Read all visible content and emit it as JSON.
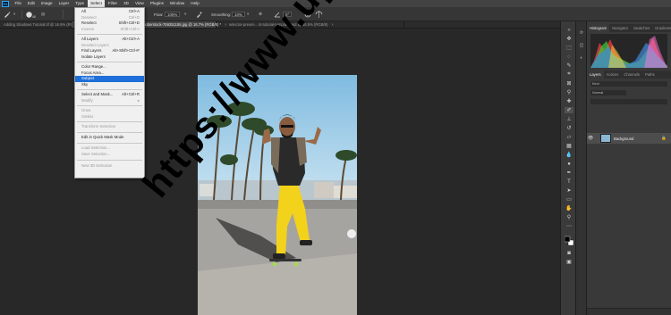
{
  "menubar": {
    "logo": "Ps",
    "items": [
      "File",
      "Edit",
      "Image",
      "Layer",
      "Type",
      "Select",
      "Filter",
      "3D",
      "View",
      "Plugins",
      "Window",
      "Help"
    ]
  },
  "options": {
    "size": "48",
    "flow": "100%",
    "smoothing": "10%",
    "angle": "0°"
  },
  "tabs": [
    {
      "label": "Adding Shadows Tutorial.tif @ 16.9% (RGB/8)",
      "close": "×"
    },
    {
      "label": "shutterstock-759251155.jpg @ 16.7% (RGB/8) *",
      "close": "×"
    },
    {
      "label": "selector-preset-...nt-tutorial-template.psd @ 16.5% (RGB/8)",
      "close": "×"
    }
  ],
  "select_menu": {
    "items": [
      {
        "label": "All",
        "shortcut": "Ctrl+A",
        "disabled": false
      },
      {
        "label": "Deselect",
        "shortcut": "Ctrl+D",
        "disabled": true
      },
      {
        "label": "Reselect",
        "shortcut": "Shift+Ctrl+D",
        "disabled": false
      },
      {
        "label": "Inverse",
        "shortcut": "Shift+Ctrl+I",
        "disabled": true
      },
      {
        "label": "All Layers",
        "shortcut": "Alt+Ctrl+A",
        "disabled": false
      },
      {
        "label": "Deselect Layers",
        "shortcut": "",
        "disabled": true
      },
      {
        "label": "Find Layers",
        "shortcut": "Alt+Shift+Ctrl+F",
        "disabled": false
      },
      {
        "label": "Isolate Layers",
        "shortcut": "",
        "disabled": false
      },
      {
        "label": "Color Range...",
        "shortcut": "",
        "disabled": false
      },
      {
        "label": "Focus Area...",
        "shortcut": "",
        "disabled": false
      },
      {
        "label": "Subject",
        "shortcut": "",
        "disabled": false,
        "highlighted": true
      },
      {
        "label": "Sky",
        "shortcut": "",
        "disabled": false
      },
      {
        "label": "Select and Mask...",
        "shortcut": "Alt+Ctrl+R",
        "disabled": false
      },
      {
        "label": "Modify",
        "shortcut": "",
        "disabled": true,
        "submenu": "▸"
      },
      {
        "label": "Grow",
        "shortcut": "",
        "disabled": true
      },
      {
        "label": "Similar",
        "shortcut": "",
        "disabled": true
      },
      {
        "label": "Transform Selection",
        "shortcut": "",
        "disabled": true
      },
      {
        "label": "Edit in Quick Mask Mode",
        "shortcut": "",
        "disabled": false
      },
      {
        "label": "Load Selection...",
        "shortcut": "",
        "disabled": true
      },
      {
        "label": "Save Selection...",
        "shortcut": "",
        "disabled": true
      },
      {
        "label": "New 3D Extrusion",
        "shortcut": "",
        "disabled": true
      }
    ]
  },
  "panels": {
    "top_tabs": [
      "Histogram",
      "Navigator",
      "Swatches",
      "Gradients"
    ],
    "layer_tabs": [
      "Layers",
      "Actions",
      "Channels",
      "Paths"
    ],
    "kind": "Kind",
    "blend": "Normal",
    "layer_name": "Background"
  },
  "watermark": "https://www.uptodays.in",
  "colors": {
    "accent": "#1e6fd9",
    "sky": "#9fcde6",
    "pants": "#f2d21a"
  }
}
